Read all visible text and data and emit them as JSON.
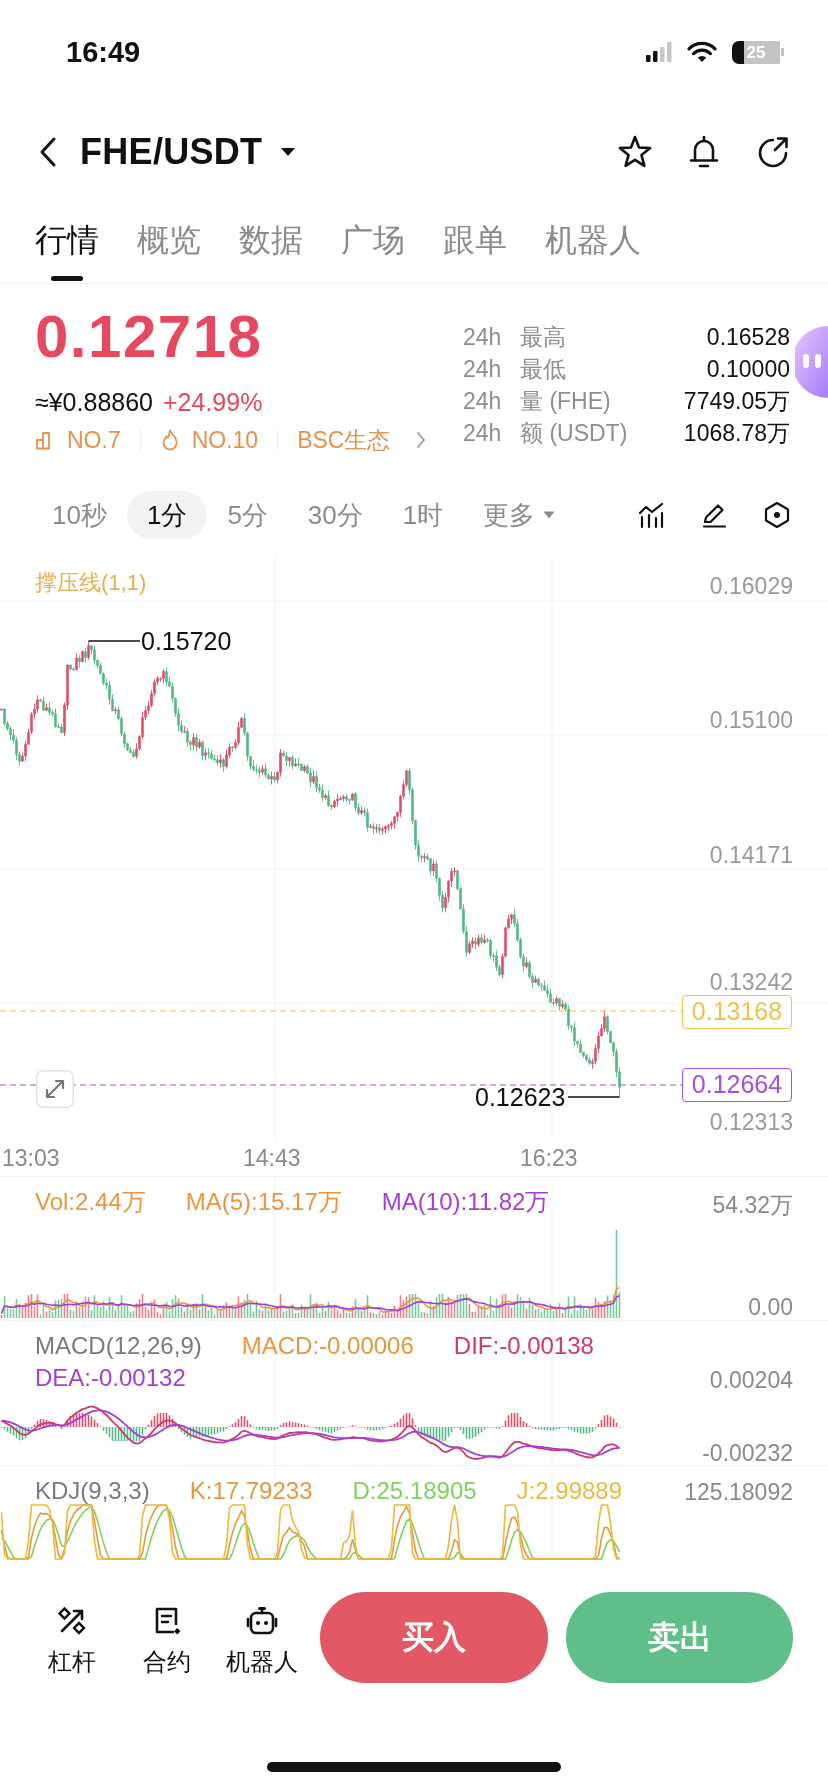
{
  "status_bar": {
    "time": "16:49",
    "battery": "25"
  },
  "header": {
    "pair": "FHE/USDT"
  },
  "tabs": [
    {
      "label": "行情",
      "selected": true
    },
    {
      "label": "概览",
      "selected": false
    },
    {
      "label": "数据",
      "selected": false
    },
    {
      "label": "广场",
      "selected": false
    },
    {
      "label": "跟单",
      "selected": false
    },
    {
      "label": "机器人",
      "selected": false
    }
  ],
  "ticker": {
    "price": "0.12718",
    "fiat": "≈¥0.88860",
    "change": "+24.99%",
    "tags": [
      {
        "kind": "rank",
        "text": "NO.7"
      },
      {
        "kind": "hot",
        "text": "NO.10"
      },
      {
        "kind": "sector",
        "text": "BSC生态"
      }
    ],
    "stats": [
      {
        "period": "24h",
        "label": "最高",
        "value": "0.16528"
      },
      {
        "period": "24h",
        "label": "最低",
        "value": "0.10000"
      },
      {
        "period": "24h",
        "label": "量 (FHE)",
        "value": "7749.05万"
      },
      {
        "period": "24h",
        "label": "额 (USDT)",
        "value": "1068.78万"
      }
    ]
  },
  "intervals": [
    {
      "kind": "interval",
      "label": "10秒",
      "selected": false
    },
    {
      "kind": "interval",
      "label": "1分",
      "selected": true
    },
    {
      "kind": "interval",
      "label": "5分",
      "selected": false
    },
    {
      "kind": "interval",
      "label": "30分",
      "selected": false
    },
    {
      "kind": "interval",
      "label": "1时",
      "selected": false
    },
    {
      "kind": "menu",
      "label": "更多",
      "selected": false
    }
  ],
  "chart": {
    "indicator": "撑压线(1,1)",
    "y_ticks": [
      "0.16029",
      "0.15100",
      "0.14171",
      "0.13242",
      "0.12313"
    ],
    "x_ticks": [
      "13:03",
      "14:43",
      "16:23"
    ],
    "high_marker": "0.15720",
    "low_marker": "0.12623",
    "price_lines": [
      {
        "kind": "resistance",
        "value": "0.13168",
        "color": "#f0c24b"
      },
      {
        "kind": "last",
        "value": "0.12664",
        "color": "#a64ee0"
      }
    ]
  },
  "volume": {
    "legend": [
      {
        "text": "Vol:2.44万",
        "color": "#e9973f"
      },
      {
        "text": "MA(5):15.17万",
        "color": "#e9973f"
      },
      {
        "text": "MA(10):11.82万",
        "color": "#a33fd6"
      }
    ],
    "y_ticks": [
      "54.32万",
      "0.00"
    ]
  },
  "macd": {
    "legend": [
      {
        "text": "MACD(12,26,9)",
        "color": "#7a7a7a"
      },
      {
        "text": "MACD:-0.00006",
        "color": "#e9973f"
      },
      {
        "text": "DIF:-0.00138",
        "color": "#d2386a"
      },
      {
        "text": "DEA:-0.00132",
        "color": "#a33fd6"
      }
    ],
    "y_ticks": [
      "0.00204",
      "-0.00232"
    ]
  },
  "kdj": {
    "legend": [
      {
        "text": "KDJ(9,3,3)",
        "color": "#7a7a7a"
      },
      {
        "text": "K:17.79233",
        "color": "#e9973f"
      },
      {
        "text": "D:25.18905",
        "color": "#7fd35a"
      },
      {
        "text": "J:2.99889",
        "color": "#f0b93a"
      }
    ],
    "y_ticks": [
      "125.18092"
    ]
  },
  "actions": {
    "tools": [
      {
        "kind": "leverage",
        "label": "杠杆"
      },
      {
        "kind": "contract",
        "label": "合约"
      },
      {
        "kind": "robot",
        "label": "机器人"
      }
    ],
    "buy": "买入",
    "sell": "卖出"
  }
}
